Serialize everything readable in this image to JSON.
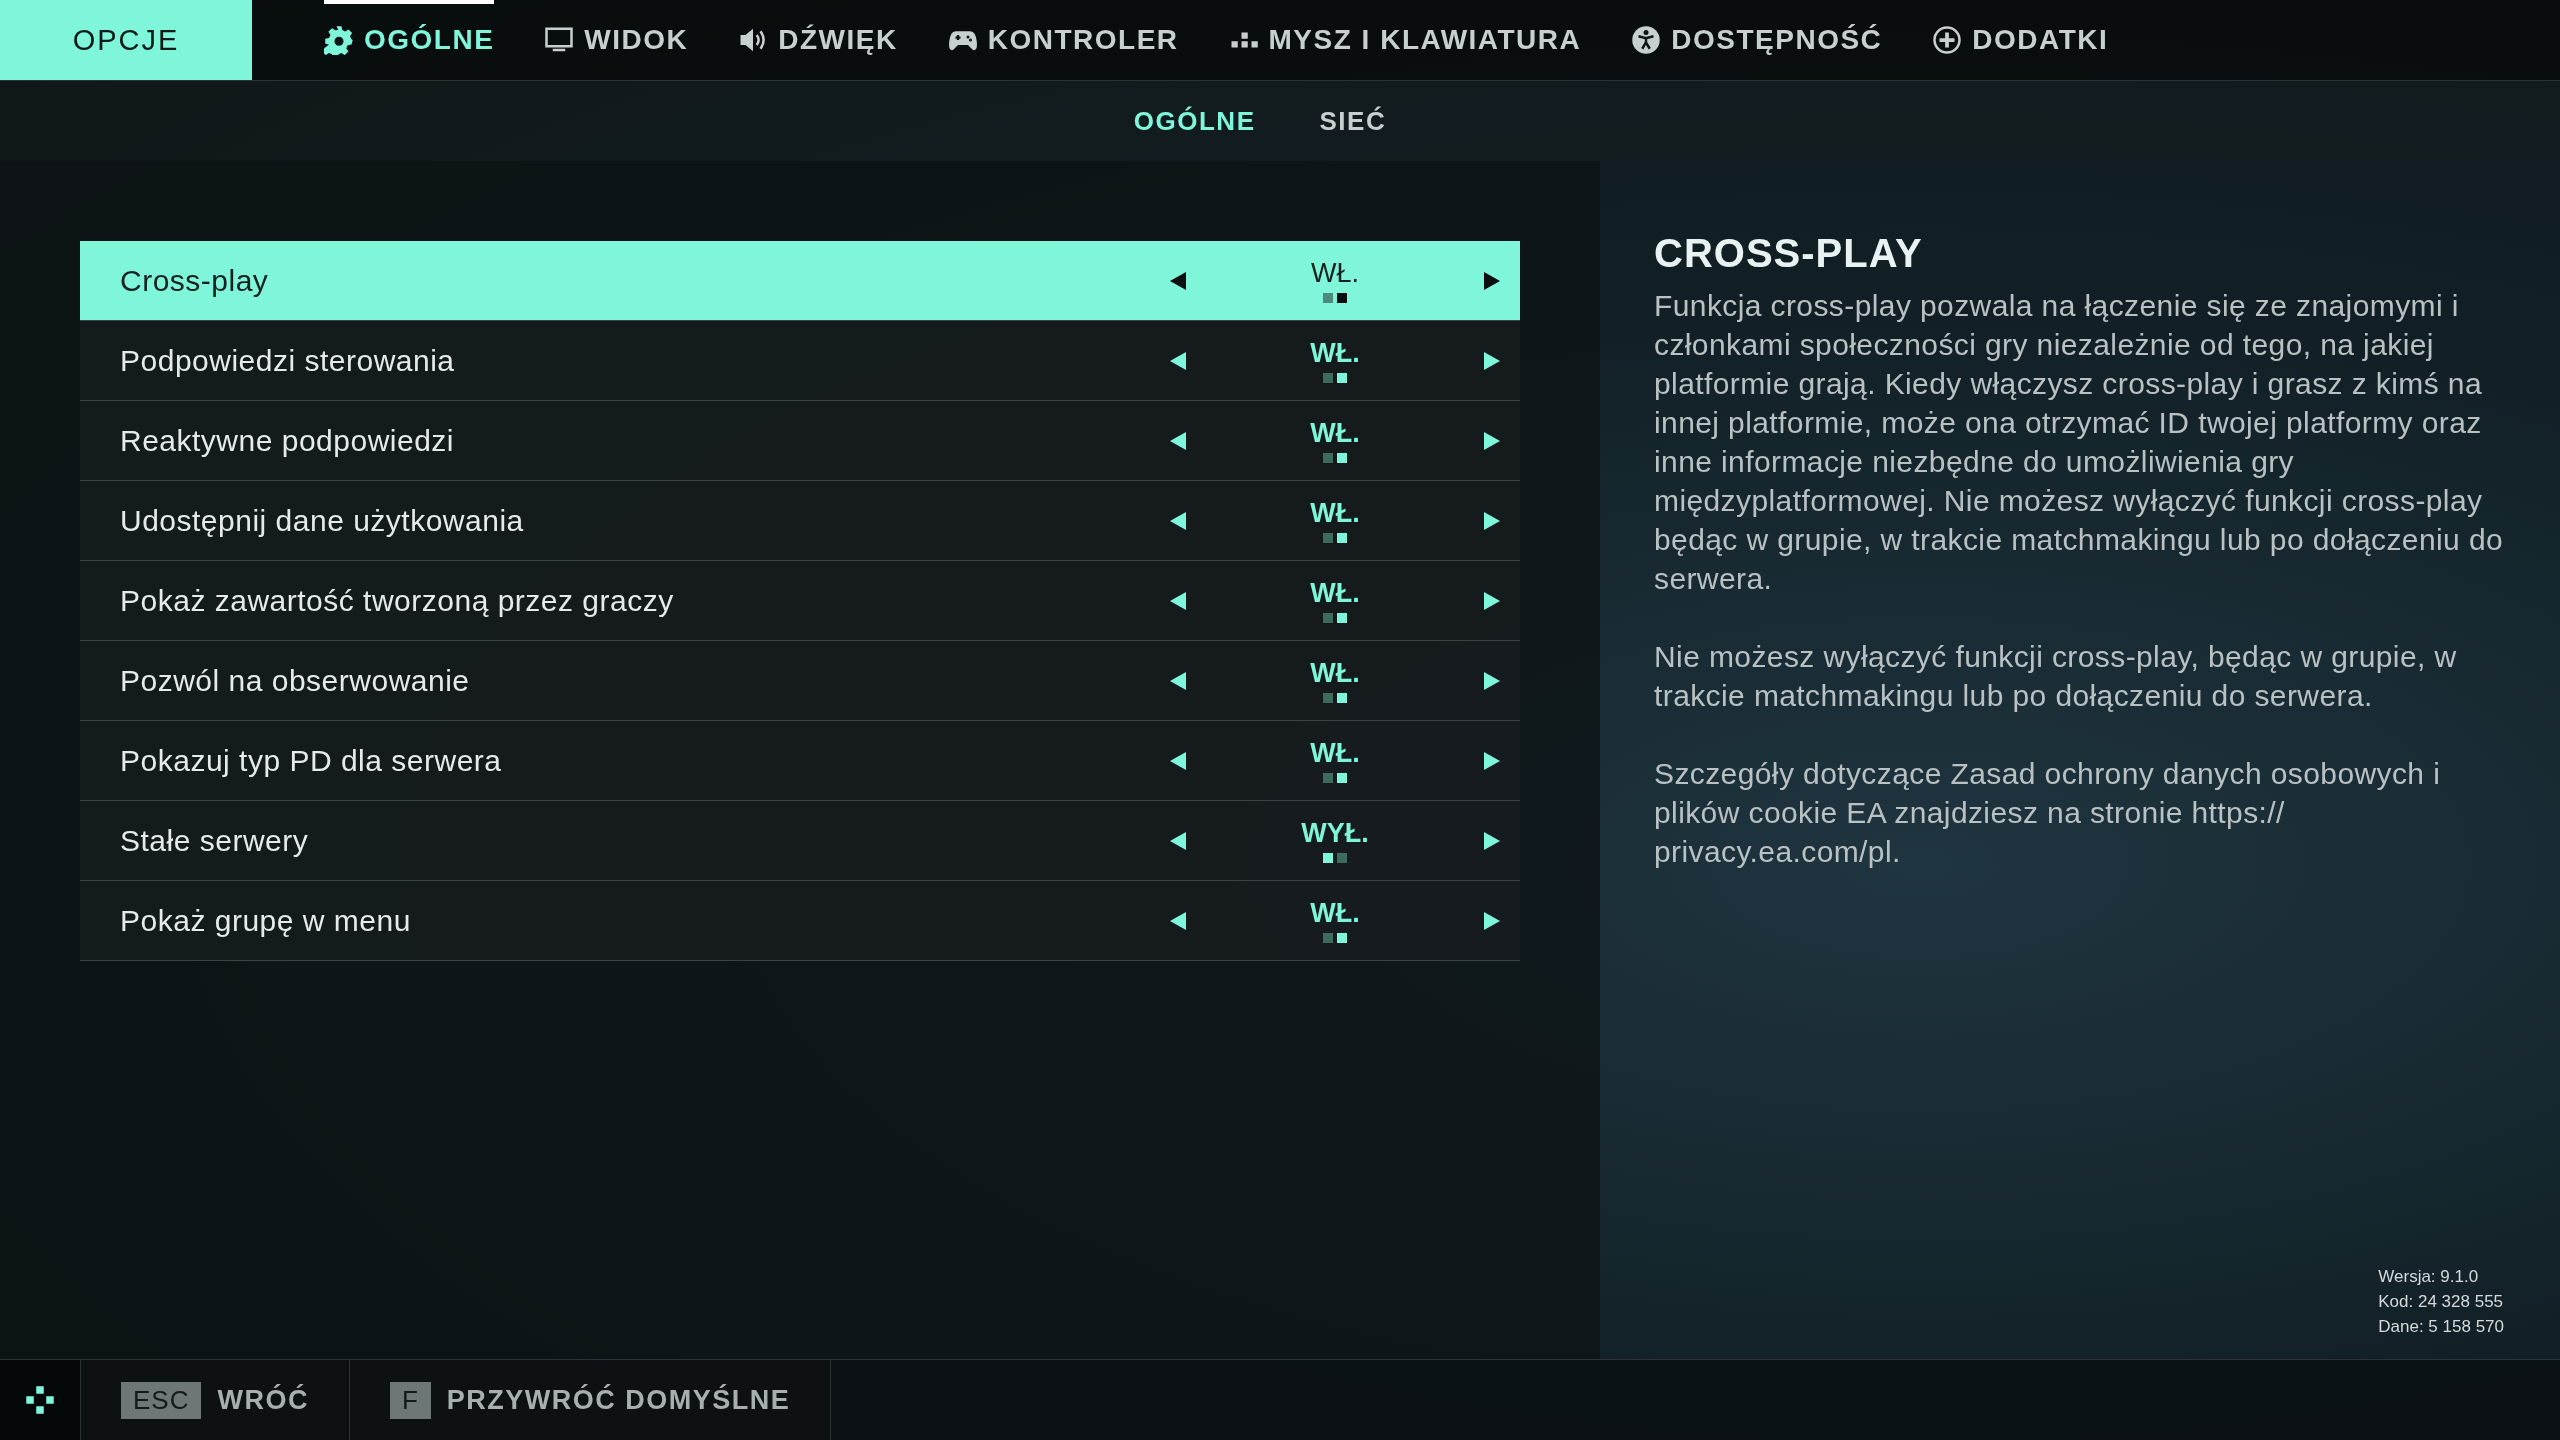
{
  "header": {
    "title": "OPCJE"
  },
  "tabs": [
    {
      "label": "OGÓLNE",
      "selected": true
    },
    {
      "label": "WIDOK",
      "selected": false
    },
    {
      "label": "DŹWIĘK",
      "selected": false
    },
    {
      "label": "KONTROLER",
      "selected": false
    },
    {
      "label": "MYSZ I KLAWIATURA",
      "selected": false
    },
    {
      "label": "DOSTĘPNOŚĆ",
      "selected": false
    },
    {
      "label": "DODATKI",
      "selected": false
    }
  ],
  "subtabs": [
    {
      "label": "OGÓLNE",
      "selected": true
    },
    {
      "label": "SIEĆ",
      "selected": false
    }
  ],
  "settings": [
    {
      "label": "Cross-play",
      "value": "WŁ.",
      "on": true,
      "selected": true
    },
    {
      "label": "Podpowiedzi sterowania",
      "value": "WŁ.",
      "on": true,
      "selected": false
    },
    {
      "label": "Reaktywne podpowiedzi",
      "value": "WŁ.",
      "on": true,
      "selected": false
    },
    {
      "label": "Udostępnij dane użytkowania",
      "value": "WŁ.",
      "on": true,
      "selected": false
    },
    {
      "label": "Pokaż zawartość tworzoną przez graczy",
      "value": "WŁ.",
      "on": true,
      "selected": false
    },
    {
      "label": "Pozwól na obserwowanie",
      "value": "WŁ.",
      "on": true,
      "selected": false
    },
    {
      "label": "Pokazuj typ PD dla serwera",
      "value": "WŁ.",
      "on": true,
      "selected": false
    },
    {
      "label": "Stałe serwery",
      "value": "WYŁ.",
      "on": false,
      "selected": false
    },
    {
      "label": "Pokaż grupę w menu",
      "value": "WŁ.",
      "on": true,
      "selected": false
    }
  ],
  "description": {
    "title": "CROSS-PLAY",
    "paragraphs": [
      "Funkcja cross-play pozwala na łączenie się ze znajomymi i członkami społeczności gry niezależnie od tego, na jakiej platformie grają. Kiedy włączysz cross-play i grasz z kimś na innej platformie, może ona otrzymać ID twojej platformy oraz inne informacje niezbędne do umożliwienia gry międzyplatformowej. Nie możesz wyłączyć funkcji cross-play będąc w grupie, w trakcie matchmakingu lub po dołączeniu do serwera.",
      "Nie możesz wyłączyć funkcji cross-play, będąc w grupie, w trakcie matchmakingu lub po dołączeniu do serwera.",
      "Szczegóły dotyczące Zasad ochrony danych osobowych i plików cookie EA znajdziesz na stronie https:// privacy.ea.com/pl."
    ]
  },
  "version_info": [
    "Wersja: 9.1.0",
    "Kod: 24 328 555",
    "Dane: 5 158 570"
  ],
  "footer": {
    "actions": [
      {
        "key": "ESC",
        "label": "WRÓĆ"
      },
      {
        "key": "F",
        "label": "PRZYWRÓĆ DOMYŚLNE"
      }
    ]
  }
}
